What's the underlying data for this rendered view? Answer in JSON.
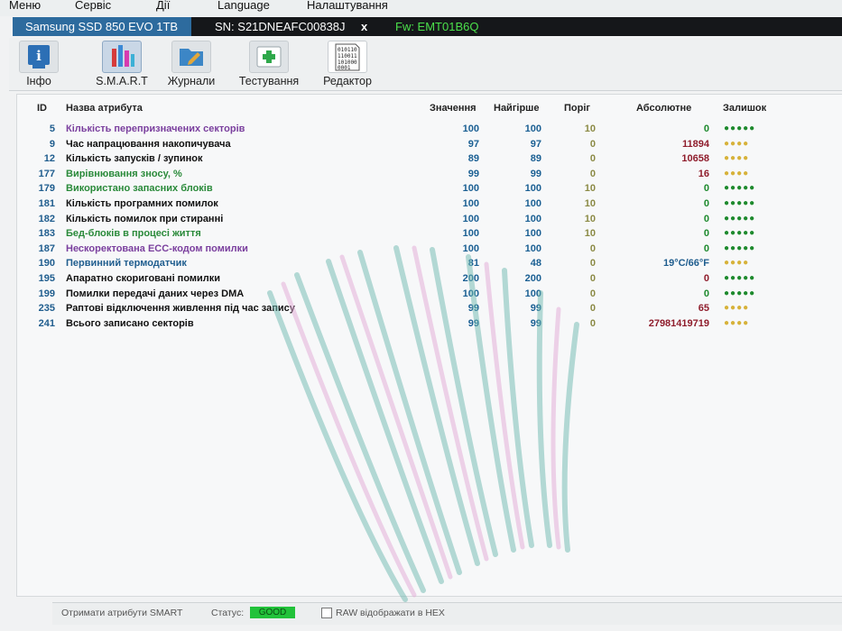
{
  "menu": [
    "Меню",
    "Сервіс",
    "Дії",
    "Language",
    "Налаштування"
  ],
  "device": {
    "model": "Samsung SSD 850 EVO 1TB",
    "serial": "SN: S21DNEAFC00838J",
    "close": "x",
    "firmware": "Fw: EMT01B6Q"
  },
  "toolbar": [
    {
      "label": "Інфо",
      "icon": "info-icon"
    },
    {
      "label": "S.M.A.R.T",
      "icon": "smart-bars-icon"
    },
    {
      "label": "Журнали",
      "icon": "journal-folder-icon"
    },
    {
      "label": "Тестування",
      "icon": "test-medkit-icon"
    },
    {
      "label": "Редактор",
      "icon": "binary-editor-icon"
    }
  ],
  "columns": {
    "id": "ID",
    "name": "Назва атрибута",
    "value": "Значення",
    "worst": "Найгірше",
    "threshold": "Поріг",
    "absolute": "Абсолютне",
    "remaining": "Залишок"
  },
  "rows": [
    {
      "id": "5",
      "name": "Кількість перепризначених секторів",
      "value": "100",
      "worst": "100",
      "threshold": "10",
      "absolute": "0",
      "remaining": "●●●●●",
      "name_color": "#7a3f9e",
      "abs_color": "#1e8a2e",
      "rem_color": "#1e8a2e"
    },
    {
      "id": "9",
      "name": "Час напрацювання накопичувача",
      "value": "97",
      "worst": "97",
      "threshold": "0",
      "absolute": "11894",
      "remaining": "●●●●",
      "name_color": "#111111",
      "abs_color": "#8f1d2c",
      "rem_color": "#d7b23a"
    },
    {
      "id": "12",
      "name": "Кількість запусків / зупинок",
      "value": "89",
      "worst": "89",
      "threshold": "0",
      "absolute": "10658",
      "remaining": "●●●●",
      "name_color": "#111111",
      "abs_color": "#8f1d2c",
      "rem_color": "#d7b23a"
    },
    {
      "id": "177",
      "name": "Вирівнювання зносу, %",
      "value": "99",
      "worst": "99",
      "threshold": "0",
      "absolute": "16",
      "remaining": "●●●●",
      "name_color": "#2a8a3a",
      "abs_color": "#8f1d2c",
      "rem_color": "#d7b23a"
    },
    {
      "id": "179",
      "name": "Використано запасних блоків",
      "value": "100",
      "worst": "100",
      "threshold": "10",
      "absolute": "0",
      "remaining": "●●●●●",
      "name_color": "#2a8a3a",
      "abs_color": "#1e8a2e",
      "rem_color": "#1e8a2e"
    },
    {
      "id": "181",
      "name": "Кількість програмних помилок",
      "value": "100",
      "worst": "100",
      "threshold": "10",
      "absolute": "0",
      "remaining": "●●●●●",
      "name_color": "#111111",
      "abs_color": "#1e8a2e",
      "rem_color": "#1e8a2e"
    },
    {
      "id": "182",
      "name": "Кількість помилок при стиранні",
      "value": "100",
      "worst": "100",
      "threshold": "10",
      "absolute": "0",
      "remaining": "●●●●●",
      "name_color": "#111111",
      "abs_color": "#1e8a2e",
      "rem_color": "#1e8a2e"
    },
    {
      "id": "183",
      "name": "Бед-блоків в процесі життя",
      "value": "100",
      "worst": "100",
      "threshold": "10",
      "absolute": "0",
      "remaining": "●●●●●",
      "name_color": "#2a8a3a",
      "abs_color": "#1e8a2e",
      "rem_color": "#1e8a2e"
    },
    {
      "id": "187",
      "name": "Нескоректована ECC-кодом помилки",
      "value": "100",
      "worst": "100",
      "threshold": "0",
      "absolute": "0",
      "remaining": "●●●●●",
      "name_color": "#7a3f9e",
      "abs_color": "#1e8a2e",
      "rem_color": "#1e8a2e"
    },
    {
      "id": "190",
      "name": "Первинний термодатчик",
      "value": "81",
      "worst": "48",
      "threshold": "0",
      "absolute": "19°C/66°F",
      "remaining": "●●●●",
      "name_color": "#1f5d8e",
      "abs_color": "#1f5d8e",
      "rem_color": "#d7b23a"
    },
    {
      "id": "195",
      "name": "Апаратно скориговані помилки",
      "value": "200",
      "worst": "200",
      "threshold": "0",
      "absolute": "0",
      "remaining": "●●●●●",
      "name_color": "#111111",
      "abs_color": "#8f1d2c",
      "rem_color": "#1e8a2e"
    },
    {
      "id": "199",
      "name": "Помилки передачі даних через DMA",
      "value": "100",
      "worst": "100",
      "threshold": "0",
      "absolute": "0",
      "remaining": "●●●●●",
      "name_color": "#111111",
      "abs_color": "#1e8a2e",
      "rem_color": "#1e8a2e"
    },
    {
      "id": "235",
      "name": "Раптові відключення живлення під час запису",
      "value": "99",
      "worst": "99",
      "threshold": "0",
      "absolute": "65",
      "remaining": "●●●●",
      "name_color": "#111111",
      "abs_color": "#8f1d2c",
      "rem_color": "#d7b23a"
    },
    {
      "id": "241",
      "name": "Всього записано секторів",
      "value": "99",
      "worst": "99",
      "threshold": "0",
      "absolute": "27981419719",
      "remaining": "●●●●",
      "name_color": "#111111",
      "abs_color": "#8f1d2c",
      "rem_color": "#d7b23a"
    }
  ],
  "statusbar": {
    "get_smart": "Отримати атрибути SMART",
    "status_label": "Статус:",
    "status_value": "GOOD",
    "status_color": "#22c23a",
    "raw_hex_label": "RAW відображати в HEX",
    "raw_hex_checked": false
  }
}
